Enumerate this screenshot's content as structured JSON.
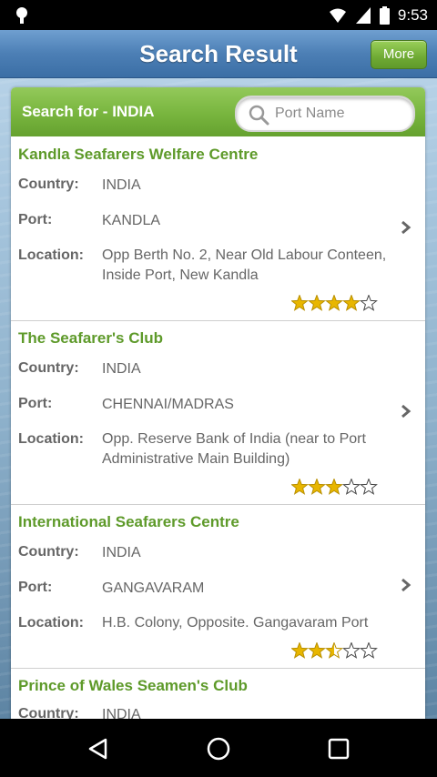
{
  "status_bar": {
    "time": "9:53"
  },
  "header": {
    "title": "Search Result",
    "more_label": "More"
  },
  "search": {
    "label": "Search for - INDIA",
    "placeholder": "Port Name"
  },
  "labels": {
    "country": "Country:",
    "port": "Port:",
    "location": "Location:"
  },
  "results": [
    {
      "name": "Kandla Seafarers Welfare Centre",
      "country": "INDIA",
      "port": "KANDLA",
      "location": "Opp Berth No. 2, Near Old Labour Conteen, Inside Port, New Kandla",
      "rating": 4
    },
    {
      "name": "The Seafarer's Club",
      "country": "INDIA",
      "port": "CHENNAI/MADRAS",
      "location": "Opp. Reserve Bank of India (near to Port Administrative Main Building)",
      "rating": 3
    },
    {
      "name": "International Seafarers Centre",
      "country": "INDIA",
      "port": "GANGAVARAM",
      "location": "H.B. Colony, Opposite. Gangavaram Port",
      "rating": 2.5
    },
    {
      "name": "Prince of Wales Seamen's Club",
      "country": "INDIA"
    }
  ],
  "colors": {
    "accent_green": "#5e9a2a",
    "header_blue": "#4c7fb5",
    "star_gold": "#e8b600"
  },
  "nav": {
    "back": "back-icon",
    "home": "home-icon",
    "recents": "recents-icon"
  }
}
